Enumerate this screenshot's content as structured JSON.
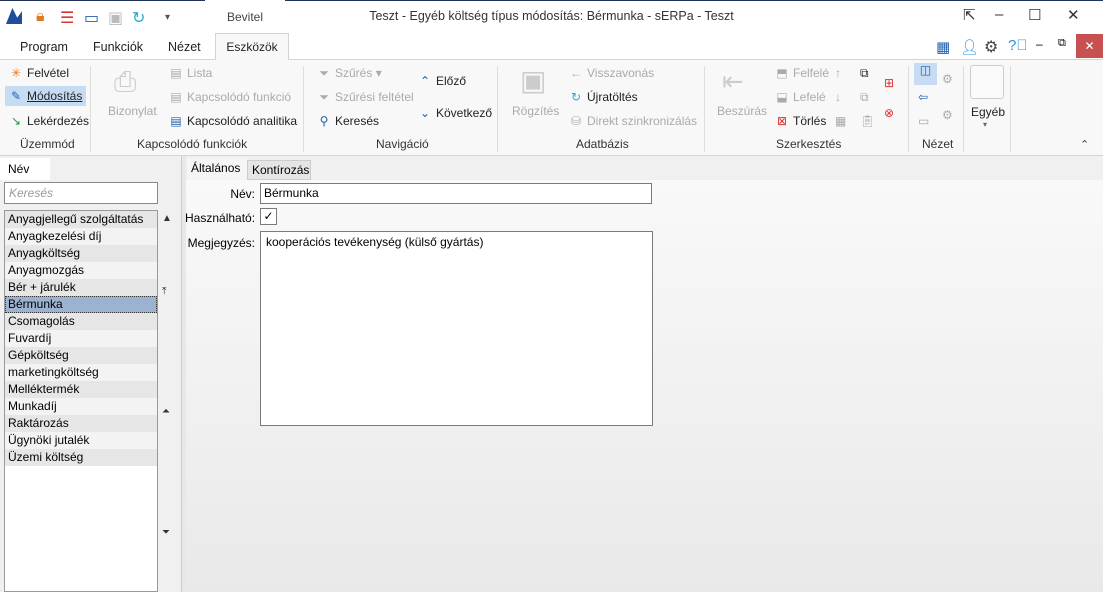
{
  "window": {
    "title": "Teszt - Egyéb költség típus módosítás: Bérmunka - sERPa - Teszt",
    "context_tab": "Bevitel"
  },
  "ribbon_tabs": [
    "Program",
    "Funkciók",
    "Nézet",
    "Eszközök"
  ],
  "ribbon": {
    "uzemmod": {
      "label": "Üzemmód",
      "items": [
        "Felvétel",
        "Módosítás",
        "Lekérdezés"
      ]
    },
    "kapcsolodo": {
      "label": "Kapcsolódó funkciók",
      "bizonylat": "Bizonylat",
      "items": [
        "Lista",
        "Kapcsolódó funkció",
        "Kapcsolódó analitika"
      ]
    },
    "navigacio": {
      "label": "Navigáció",
      "items": [
        "Szűrés",
        "Szűrési feltétel",
        "Keresés"
      ],
      "prev": "Előző",
      "next": "Következő"
    },
    "adatbazis": {
      "label": "Adatbázis",
      "rogzites": "Rögzítés",
      "items": [
        "Visszavonás",
        "Újratöltés",
        "Direkt szinkronizálás"
      ]
    },
    "szerkesztes": {
      "label": "Szerkesztés",
      "beszuras": "Beszúrás",
      "items": [
        "Felfelé",
        "Lefelé",
        "Törlés"
      ]
    },
    "nezet": {
      "label": "Nézet"
    },
    "egyeb": {
      "label": "Egyéb"
    }
  },
  "left": {
    "tab": "Név",
    "search_placeholder": "Keresés",
    "selected": "Bérmunka",
    "items": [
      "Anyagjellegű szolgáltatás",
      "Anyagkezelési díj",
      "Anyagköltség",
      "Anyagmozgás",
      "Bér + járulék",
      "Bérmunka",
      "Csomagolás",
      "Fuvardíj",
      "Gépköltség",
      "marketingköltség",
      "Melléktermék",
      "Munkadíj",
      "Raktározás",
      "Ügynöki jutalék",
      "Üzemi költség"
    ]
  },
  "form": {
    "tabs": [
      "Általános",
      "Kontírozás"
    ],
    "name_label": "Név:",
    "name_value": "Bérmunka",
    "usable_label": "Használható:",
    "usable_checked": "✓",
    "note_label": "Megjegyzés:",
    "note_value": "kooperációs tevékenység (külső gyártás)"
  }
}
